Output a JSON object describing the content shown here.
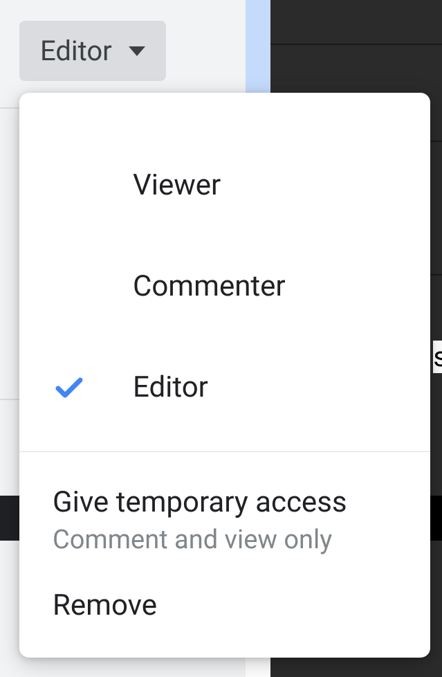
{
  "roleButton": {
    "label": "Editor"
  },
  "menu": {
    "options": [
      {
        "label": "Viewer",
        "selected": false
      },
      {
        "label": "Commenter",
        "selected": false
      },
      {
        "label": "Editor",
        "selected": true
      }
    ],
    "actions": {
      "tempAccess": {
        "label": "Give temporary access",
        "sublabel": "Comment and view only"
      },
      "remove": {
        "label": "Remove"
      }
    }
  },
  "peekChar": "s"
}
